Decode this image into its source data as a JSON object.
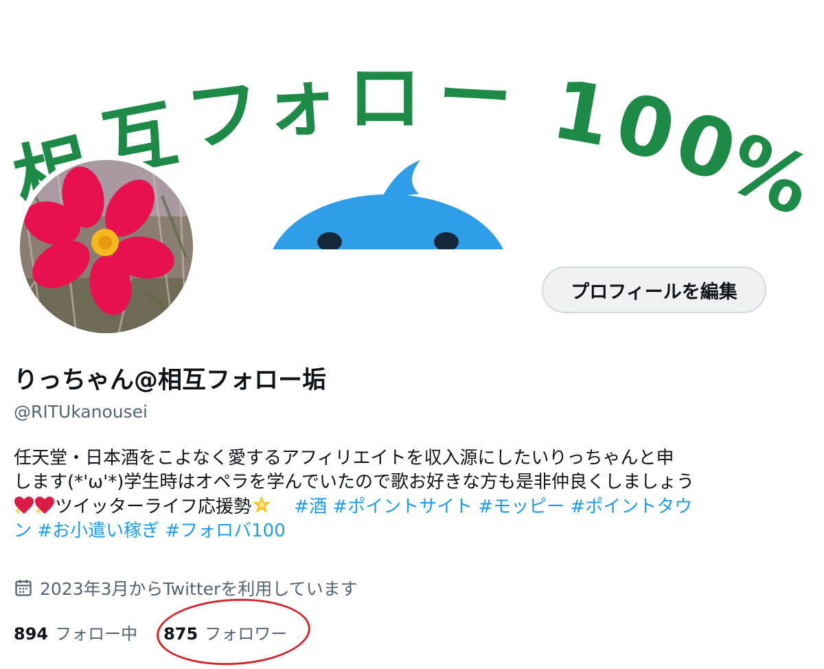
{
  "banner": {
    "text_chars": [
      "相",
      "互",
      "フ",
      "ォ",
      "ロ",
      "ー",
      "1",
      "0",
      "0",
      "%"
    ],
    "text_color": "#1e8a47",
    "bird_color": "#2f9ee8",
    "icon": "blue-bird-mascot"
  },
  "avatar": {
    "icon": "pink-cosmos-flower",
    "petal_color": "#e8114f",
    "center_color": "#f5b81e"
  },
  "profile": {
    "edit_button_label": "プロフィールを編集",
    "display_name": "りっちゃん@相互フォロー垢",
    "handle": "@RITUkanousei"
  },
  "bio": {
    "line1": "任天堂・日本酒をこよなく愛するアフィリエイトを収入源にしたいりっちゃんと申",
    "line2": "します(*'ω'*)学生時はオペラを学んでいたので歌お好きな方も是非仲良くしましょう",
    "line3_text": "ツイッターライフ応援勢",
    "emojis": {
      "hearts": "sparkling-heart",
      "star": "glowing-star"
    },
    "hashtags": [
      "#酒",
      "#ポイントサイト",
      "#モッピー",
      "#ポイントタウ",
      "ン",
      "#お小遣い稼ぎ",
      "#フォロバ100"
    ]
  },
  "joined": {
    "icon": "calendar-icon",
    "text": "2023年3月からTwitterを利用しています"
  },
  "stats": {
    "following_count": "894",
    "following_label": "フォロー中",
    "followers_count": "875",
    "followers_label": "フォロワー"
  },
  "colors": {
    "link": "#1d9bf0",
    "secondary_text": "#536471",
    "annotation_circle": "#d6242b"
  }
}
